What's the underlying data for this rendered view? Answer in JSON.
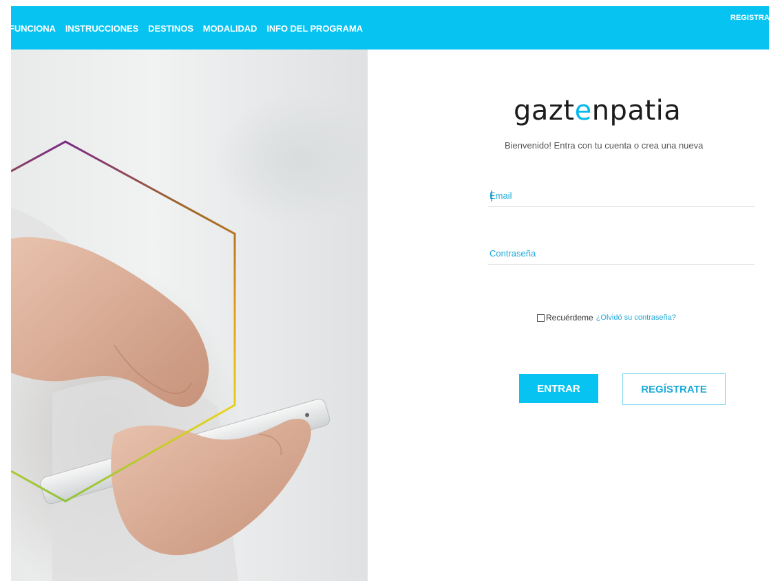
{
  "nav": {
    "items": [
      {
        "label": "FUNCIONA"
      },
      {
        "label": "INSTRUCCIONES"
      },
      {
        "label": "DESTINOS"
      },
      {
        "label": "MODALIDAD"
      },
      {
        "label": "INFO DEL PROGRAMA"
      }
    ],
    "right_label": "REGISTRATE"
  },
  "login": {
    "logo_prefix": "gazt",
    "logo_e": "e",
    "logo_suffix": "npatia",
    "welcome": "Bienvenido! Entra con tu cuenta o crea una nueva",
    "email_placeholder": "Email",
    "password_placeholder": "Contraseña",
    "remember_label": "Recuérdeme",
    "forgot_link": "¿Olvidó su contraseña?",
    "enter_button": "ENTRAR",
    "register_button": "REGÍSTRATE"
  },
  "colors": {
    "brand_blue": "#06c3f2",
    "link_blue": "#1ea9d8",
    "hexagon_gradient": [
      "#7b2a8a",
      "#a0682a",
      "#e59a1a",
      "#e8d21e",
      "#8fc43a"
    ]
  },
  "hero": {
    "image_description_icon": "hand-holding-smartphone-photo"
  }
}
